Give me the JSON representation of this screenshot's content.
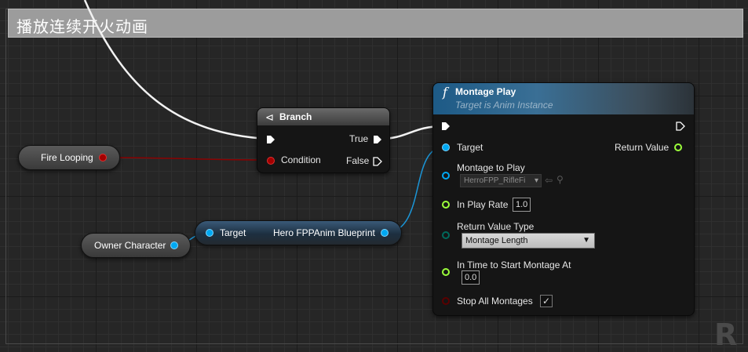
{
  "comment": {
    "title": "播放连续开火动画"
  },
  "fire_looping": {
    "label": "Fire Looping"
  },
  "owner_character": {
    "label": "Owner Character"
  },
  "cast_node": {
    "target_label": "Target",
    "output_label": "Hero FPPAnim Blueprint"
  },
  "branch": {
    "title": "Branch",
    "condition_label": "Condition",
    "true_label": "True",
    "false_label": "False"
  },
  "montage_play": {
    "title": "Montage Play",
    "subtitle": "Target is Anim Instance",
    "target_label": "Target",
    "return_value_label": "Return Value",
    "montage_to_play_label": "Montage to Play",
    "montage_to_play_value": "HerroFPP_RifleFi",
    "in_play_rate_label": "In Play Rate",
    "in_play_rate_value": "1.0",
    "return_value_type_label": "Return Value Type",
    "return_value_type_value": "Montage Length",
    "in_time_label": "In Time to Start Montage At",
    "in_time_value": "0.0",
    "stop_all_label": "Stop All Montages",
    "stop_all_checked": true
  },
  "watermark": {
    "text": "R"
  },
  "colors": {
    "bool_pin": "#a30000",
    "object_pin": "#00a8f2",
    "float_pin": "#9cff3b",
    "enum_pin": "#00695c",
    "exec_pin": "#ffffff",
    "branch_header": "#4a4a4a",
    "function_header": "#1c4a6e"
  }
}
